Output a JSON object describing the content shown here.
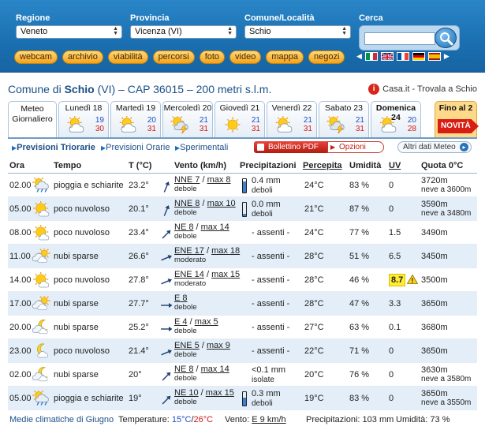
{
  "top": {
    "regione": {
      "label": "Regione",
      "value": "Veneto"
    },
    "provincia": {
      "label": "Provincia",
      "value": "Vicenza (VI)"
    },
    "comune": {
      "label": "Comune/Località",
      "value": "Schio"
    },
    "search": {
      "label": "Cerca",
      "value": ""
    },
    "nav": [
      "webcam",
      "archivio",
      "viabilità",
      "percorsi",
      "foto",
      "video",
      "mappa",
      "negozi"
    ],
    "flags": [
      "italy-flag",
      "uk-flag",
      "france-flag",
      "germany-flag",
      "spain-flag"
    ]
  },
  "location": {
    "prefix": "Comune di",
    "name": "Schio",
    "rest": "(VI) – CAP 36015 – 200 metri s.l.m.",
    "casa_link": "Casa.it - Trovala a Schio"
  },
  "tabs": {
    "meteo_line1": "Meteo",
    "meteo_line2": "Giornaliero",
    "days": [
      {
        "day": "Lunedì 18",
        "icon": "partly-cloudy-icon",
        "min": "19",
        "max": "30"
      },
      {
        "day": "Martedì 19",
        "icon": "partly-cloudy-icon",
        "min": "20",
        "max": "31"
      },
      {
        "day": "Mercoledì 20",
        "icon": "thunderstorm-icon",
        "min": "21",
        "max": "31"
      },
      {
        "day": "Giovedì 21",
        "icon": "sun-icon",
        "min": "21",
        "max": "31"
      },
      {
        "day": "Venerdì 22",
        "icon": "partly-cloudy-icon",
        "min": "21",
        "max": "31"
      },
      {
        "day": "Sabato 23",
        "icon": "thunderstorm-icon",
        "min": "21",
        "max": "31"
      },
      {
        "day": "Domenica 24",
        "icon": "partly-cloudy-icon",
        "min": "20",
        "max": "28"
      }
    ],
    "fino": "Fino al 2",
    "novita": "NOVITÀ"
  },
  "subbar": {
    "triorarie": "Previsioni Triorarie",
    "orarie": "Previsioni Orarie",
    "sperimentali": "Sperimentali",
    "pdf": "Bollettino PDF",
    "opzioni": "Opzioni",
    "altri": "Altri dati Meteo"
  },
  "table": {
    "headers": {
      "ora": "Ora",
      "tempo": "Tempo",
      "temp": "T (°C)",
      "vento": "Vento (km/h)",
      "prec": "Precipitazioni",
      "perc": "Percepita",
      "umid": "Umidità",
      "uv": "UV",
      "quota": "Quota 0°C"
    },
    "rows": [
      {
        "ora": "02.00",
        "icon": "rain-sun-icon",
        "tempo": "pioggia e schiarite",
        "temp": "23.2°",
        "wind_dir": "NNE",
        "wind1": "NNE 7",
        "wind_max": "max 8",
        "wind2": "debole",
        "prec1": "0.4 mm",
        "prec2": "deboli",
        "rain": 0.4,
        "perc": "24°C",
        "umid": "83 %",
        "uv": "0",
        "uv_high": false,
        "quota1": "3720m",
        "quota2": "neve a 3600m"
      },
      {
        "ora": "05.00",
        "icon": "mostly-sunny-icon",
        "tempo": "poco nuvoloso",
        "temp": "20.1°",
        "wind_dir": "NNE",
        "wind1": "NNE 8",
        "wind_max": "max 10",
        "wind2": "debole",
        "prec1": "0.0 mm",
        "prec2": "deboli",
        "rain": 0.1,
        "perc": "21°C",
        "umid": "87 %",
        "uv": "0",
        "uv_high": false,
        "quota1": "3590m",
        "quota2": "neve a 3480m"
      },
      {
        "ora": "08.00",
        "icon": "mostly-sunny-icon",
        "tempo": "poco nuvoloso",
        "temp": "23.4°",
        "wind_dir": "NE",
        "wind1": "NE 8",
        "wind_max": "max 14",
        "wind2": "debole",
        "prec1": "- assenti -",
        "prec2": "",
        "rain": 0,
        "perc": "24°C",
        "umid": "77 %",
        "uv": "1.5",
        "uv_high": false,
        "quota1": "3490m",
        "quota2": ""
      },
      {
        "ora": "11.00",
        "icon": "scattered-clouds-icon",
        "tempo": "nubi sparse",
        "temp": "26.6°",
        "wind_dir": "ENE",
        "wind1": "ENE 17",
        "wind_max": "max 18",
        "wind2": "moderato",
        "prec1": "- assenti -",
        "prec2": "",
        "rain": 0,
        "perc": "28°C",
        "umid": "51 %",
        "uv": "6.5",
        "uv_high": false,
        "quota1": "3450m",
        "quota2": ""
      },
      {
        "ora": "14.00",
        "icon": "mostly-sunny-icon",
        "tempo": "poco nuvoloso",
        "temp": "27.8°",
        "wind_dir": "ENE",
        "wind1": "ENE 14",
        "wind_max": "max 15",
        "wind2": "moderato",
        "prec1": "- assenti -",
        "prec2": "",
        "rain": 0,
        "perc": "28°C",
        "umid": "46 %",
        "uv": "8.7",
        "uv_high": true,
        "quota1": "3500m",
        "quota2": ""
      },
      {
        "ora": "17.00",
        "icon": "scattered-clouds-icon",
        "tempo": "nubi sparse",
        "temp": "27.7°",
        "wind_dir": "E",
        "wind1": "E 8",
        "wind_max": "",
        "wind2": "debole",
        "prec1": "- assenti -",
        "prec2": "",
        "rain": 0,
        "perc": "28°C",
        "umid": "47 %",
        "uv": "3.3",
        "uv_high": false,
        "quota1": "3650m",
        "quota2": ""
      },
      {
        "ora": "20.00",
        "icon": "scattered-clouds-night-icon",
        "tempo": "nubi sparse",
        "temp": "25.2°",
        "wind_dir": "E",
        "wind1": "E 4",
        "wind_max": "max 5",
        "wind2": "debole",
        "prec1": "- assenti -",
        "prec2": "",
        "rain": 0,
        "perc": "27°C",
        "umid": "63 %",
        "uv": "0.1",
        "uv_high": false,
        "quota1": "3680m",
        "quota2": ""
      },
      {
        "ora": "23.00",
        "icon": "partly-cloudy-night-icon",
        "tempo": "poco nuvoloso",
        "temp": "21.4°",
        "wind_dir": "ENE",
        "wind1": "ENE 5",
        "wind_max": "max 9",
        "wind2": "debole",
        "prec1": "- assenti -",
        "prec2": "",
        "rain": 0,
        "perc": "22°C",
        "umid": "71 %",
        "uv": "0",
        "uv_high": false,
        "quota1": "3650m",
        "quota2": ""
      },
      {
        "ora": "02.00",
        "icon": "scattered-clouds-night-icon",
        "tempo": "nubi sparse",
        "temp": "20°",
        "wind_dir": "NE",
        "wind1": "NE 8",
        "wind_max": "max 14",
        "wind2": "debole",
        "prec1": "<0.1 mm",
        "prec2": "isolate",
        "rain": 0,
        "perc": "20°C",
        "umid": "76 %",
        "uv": "0",
        "uv_high": false,
        "quota1": "3630m",
        "quota2": "neve a 3580m"
      },
      {
        "ora": "05.00",
        "icon": "rain-sun-icon",
        "tempo": "pioggia e schiarite",
        "temp": "19°",
        "wind_dir": "NE",
        "wind1": "NE 10",
        "wind_max": "max 15",
        "wind2": "debole",
        "prec1": "0.3 mm",
        "prec2": "deboli",
        "rain": 0.3,
        "perc": "19°C",
        "umid": "83 %",
        "uv": "0",
        "uv_high": false,
        "quota1": "3650m",
        "quota2": "neve a 3550m"
      }
    ]
  },
  "footer": {
    "medie": "Medie climatiche di Giugno",
    "temp_label": "Temperature:",
    "temp_min": "15°C",
    "temp_sep": "/",
    "temp_max": "26°C",
    "vento_label": "Vento:",
    "vento_val": "E 9 km/h",
    "prec_label": "Precipitazioni:",
    "prec_val": "103 mm",
    "umid_label": "Umidità:",
    "umid_val": "73 %"
  },
  "colors": {
    "accent": "#1a6fb0",
    "min": "#1f4fc2",
    "max": "#d01818",
    "alt_row": "#e3eef8"
  }
}
